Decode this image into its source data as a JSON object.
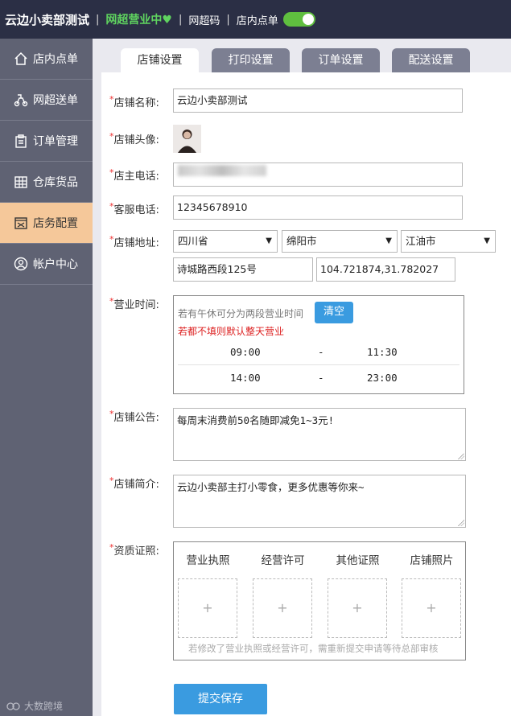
{
  "header": {
    "brand": "云边小卖部测试",
    "status": "网超营业中♥",
    "qr_link": "网超码",
    "dine_in": "店内点单",
    "toggle_on": true
  },
  "sidebar": {
    "items": [
      {
        "label": "店内点单",
        "icon": "home-icon"
      },
      {
        "label": "网超送单",
        "icon": "delivery-icon"
      },
      {
        "label": "订单管理",
        "icon": "order-icon"
      },
      {
        "label": "仓库货品",
        "icon": "warehouse-icon"
      },
      {
        "label": "店务配置",
        "icon": "store-config-icon",
        "active": true
      },
      {
        "label": "帐户中心",
        "icon": "account-icon"
      }
    ],
    "watermark": "大数跨境"
  },
  "tabs": [
    "店铺设置",
    "打印设置",
    "订单设置",
    "配送设置"
  ],
  "form": {
    "store_name_label": "店铺名称:",
    "store_name": "云边小卖部测试",
    "avatar_label": "店铺头像:",
    "owner_phone_label": "店主电话:",
    "service_phone_label": "客服电话:",
    "service_phone": "12345678910",
    "address_label": "店铺地址:",
    "province": "四川省",
    "city": "绵阳市",
    "district": "江油市",
    "street": "诗城路西段125号",
    "coords": "104.721874,31.782027",
    "hours_label": "营业时间:",
    "hours_hint": "若有午休可分为两段营业时间",
    "clear_btn": "清空",
    "hours_warn": "若都不填则默认整天营业",
    "slots": [
      {
        "start": "09:00",
        "dash": "-",
        "end": "11:30"
      },
      {
        "start": "14:00",
        "dash": "-",
        "end": "23:00"
      }
    ],
    "notice_label": "店铺公告:",
    "notice": "每周末消费前50名随即减免1~3元!",
    "intro_label": "店铺简介:",
    "intro": "云边小卖部主打小零食，更多优惠等你来~",
    "cert_label": "资质证照:",
    "certs": [
      "营业执照",
      "经营许可",
      "其他证照",
      "店铺照片"
    ],
    "cert_plus": "+",
    "cert_note": "若修改了营业执照或经营许可，需重新提交申请等待总部审核",
    "submit": "提交保存"
  },
  "colors": {
    "topbar": "#2b2f45",
    "sidebar": "#5f6273",
    "sidebar_active": "#f5c89a",
    "accent": "#3a9be0",
    "status_green": "#5fd35f"
  }
}
